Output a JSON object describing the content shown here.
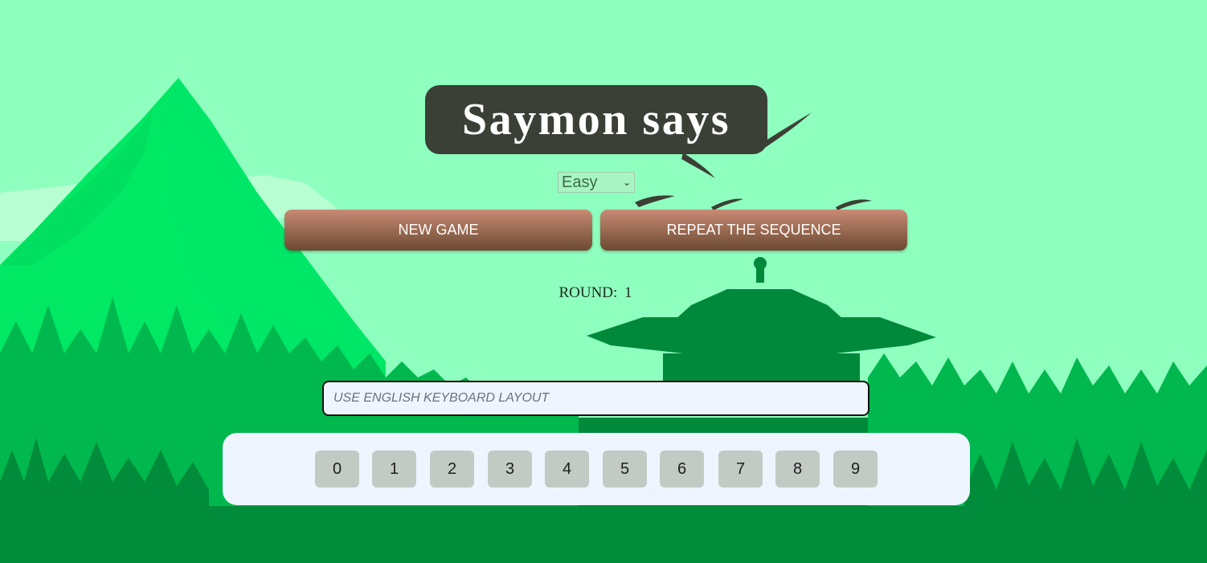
{
  "title": "Saymon says",
  "difficulty": {
    "selected": "Easy"
  },
  "buttons": {
    "new_game": "NEW GAME",
    "repeat": "REPEAT THE SEQUENCE"
  },
  "round": {
    "label": "ROUND:",
    "value": "1"
  },
  "input": {
    "placeholder": "USE ENGLISH KEYBOARD LAYOUT",
    "value": ""
  },
  "keys": [
    "0",
    "1",
    "2",
    "3",
    "4",
    "5",
    "6",
    "7",
    "8",
    "9"
  ],
  "colors": {
    "sky": "#8fffbf",
    "mountain": "#00e864",
    "forest_far": "#00b84e",
    "forest_near": "#008c3a",
    "temple": "#00893b",
    "title_bg": "#3a4036",
    "button_top": "#c98b74",
    "button_bottom": "#6b4a31",
    "panel": "#eef5ff",
    "key": "#c2cac4"
  }
}
